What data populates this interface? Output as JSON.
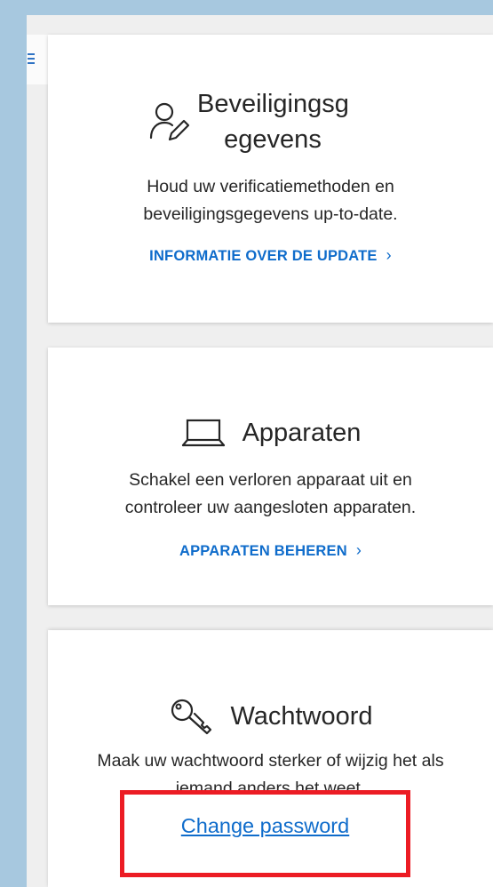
{
  "cards": [
    {
      "title_line1": "Beveiligingsg",
      "title_line2": "egevens",
      "description_line1": "Houd uw verificatiemethoden en",
      "description_line2": "beveiligingsgegevens up-to-date.",
      "link_label": "INFORMATIE OVER DE UPDATE",
      "icon": "person-edit-icon"
    },
    {
      "title": "Apparaten",
      "description_line1": "Schakel een verloren apparaat uit en",
      "description_line2": "controleer uw aangesloten apparaten.",
      "link_label": "APPARATEN BEHEREN",
      "icon": "laptop-icon"
    },
    {
      "title": "Wachtwoord",
      "description_line1": "Maak uw wachtwoord sterker of wijzig het als",
      "description_line2": "iemand anders het weet.",
      "link_label": "Change password",
      "icon": "key-icon"
    }
  ],
  "chevron": "›",
  "colors": {
    "background": "#a7c8df",
    "page": "#efefef",
    "card": "#ffffff",
    "link": "#0f6ccb",
    "highlight": "#ec1c24"
  }
}
